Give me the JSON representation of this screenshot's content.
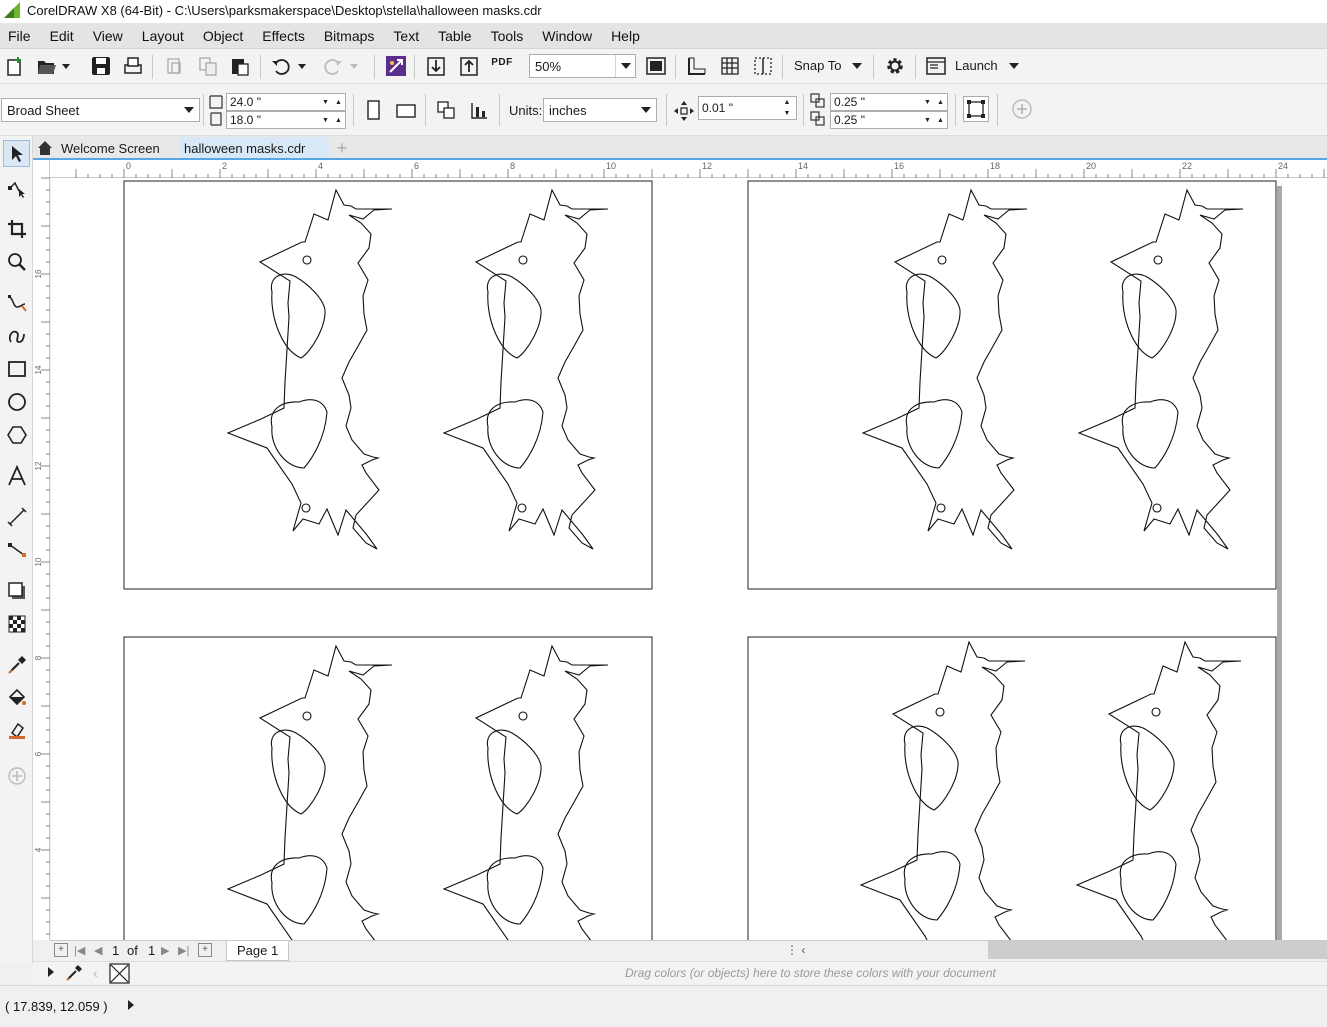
{
  "window": {
    "title": "CorelDRAW X8 (64-Bit) - C:\\Users\\parksmakerspace\\Desktop\\stella\\halloween masks.cdr",
    "logo_color": "#6fb52c"
  },
  "menu": [
    "File",
    "Edit",
    "View",
    "Layout",
    "Object",
    "Effects",
    "Bitmaps",
    "Text",
    "Table",
    "Tools",
    "Window",
    "Help"
  ],
  "toolbar": {
    "zoom": "50%",
    "pdf_label": "PDF",
    "snap_to": "Snap To",
    "launch": "Launch"
  },
  "property_bar": {
    "page_size": "Broad Sheet",
    "width": "24.0 \"",
    "height": "18.0 \"",
    "units_label": "Units:",
    "units": "inches",
    "nudge": "0.01 \"",
    "dup_x": "0.25 \"",
    "dup_y": "0.25 \""
  },
  "tabs": {
    "welcome": "Welcome Screen",
    "document": "halloween masks.cdr"
  },
  "rulers": {
    "horizontal": [
      "0",
      "2",
      "4",
      "6",
      "8",
      "10",
      "12",
      "14",
      "16",
      "18",
      "20",
      "22",
      "24"
    ],
    "vertical": [
      "16",
      "14",
      "12",
      "10",
      "8",
      "6",
      "4"
    ]
  },
  "page_nav": {
    "current": "1",
    "of": "of",
    "total": "1",
    "page_tab": "Page 1"
  },
  "palette": {
    "hint": "Drag colors (or objects) here to store these colors with your document"
  },
  "status": {
    "cursor": "( 17.839, 12.059 )"
  },
  "colors": {
    "accent": "#58a7e0",
    "tab_active": "#d9e8f7",
    "effect_icon": "#5b2d8c"
  }
}
